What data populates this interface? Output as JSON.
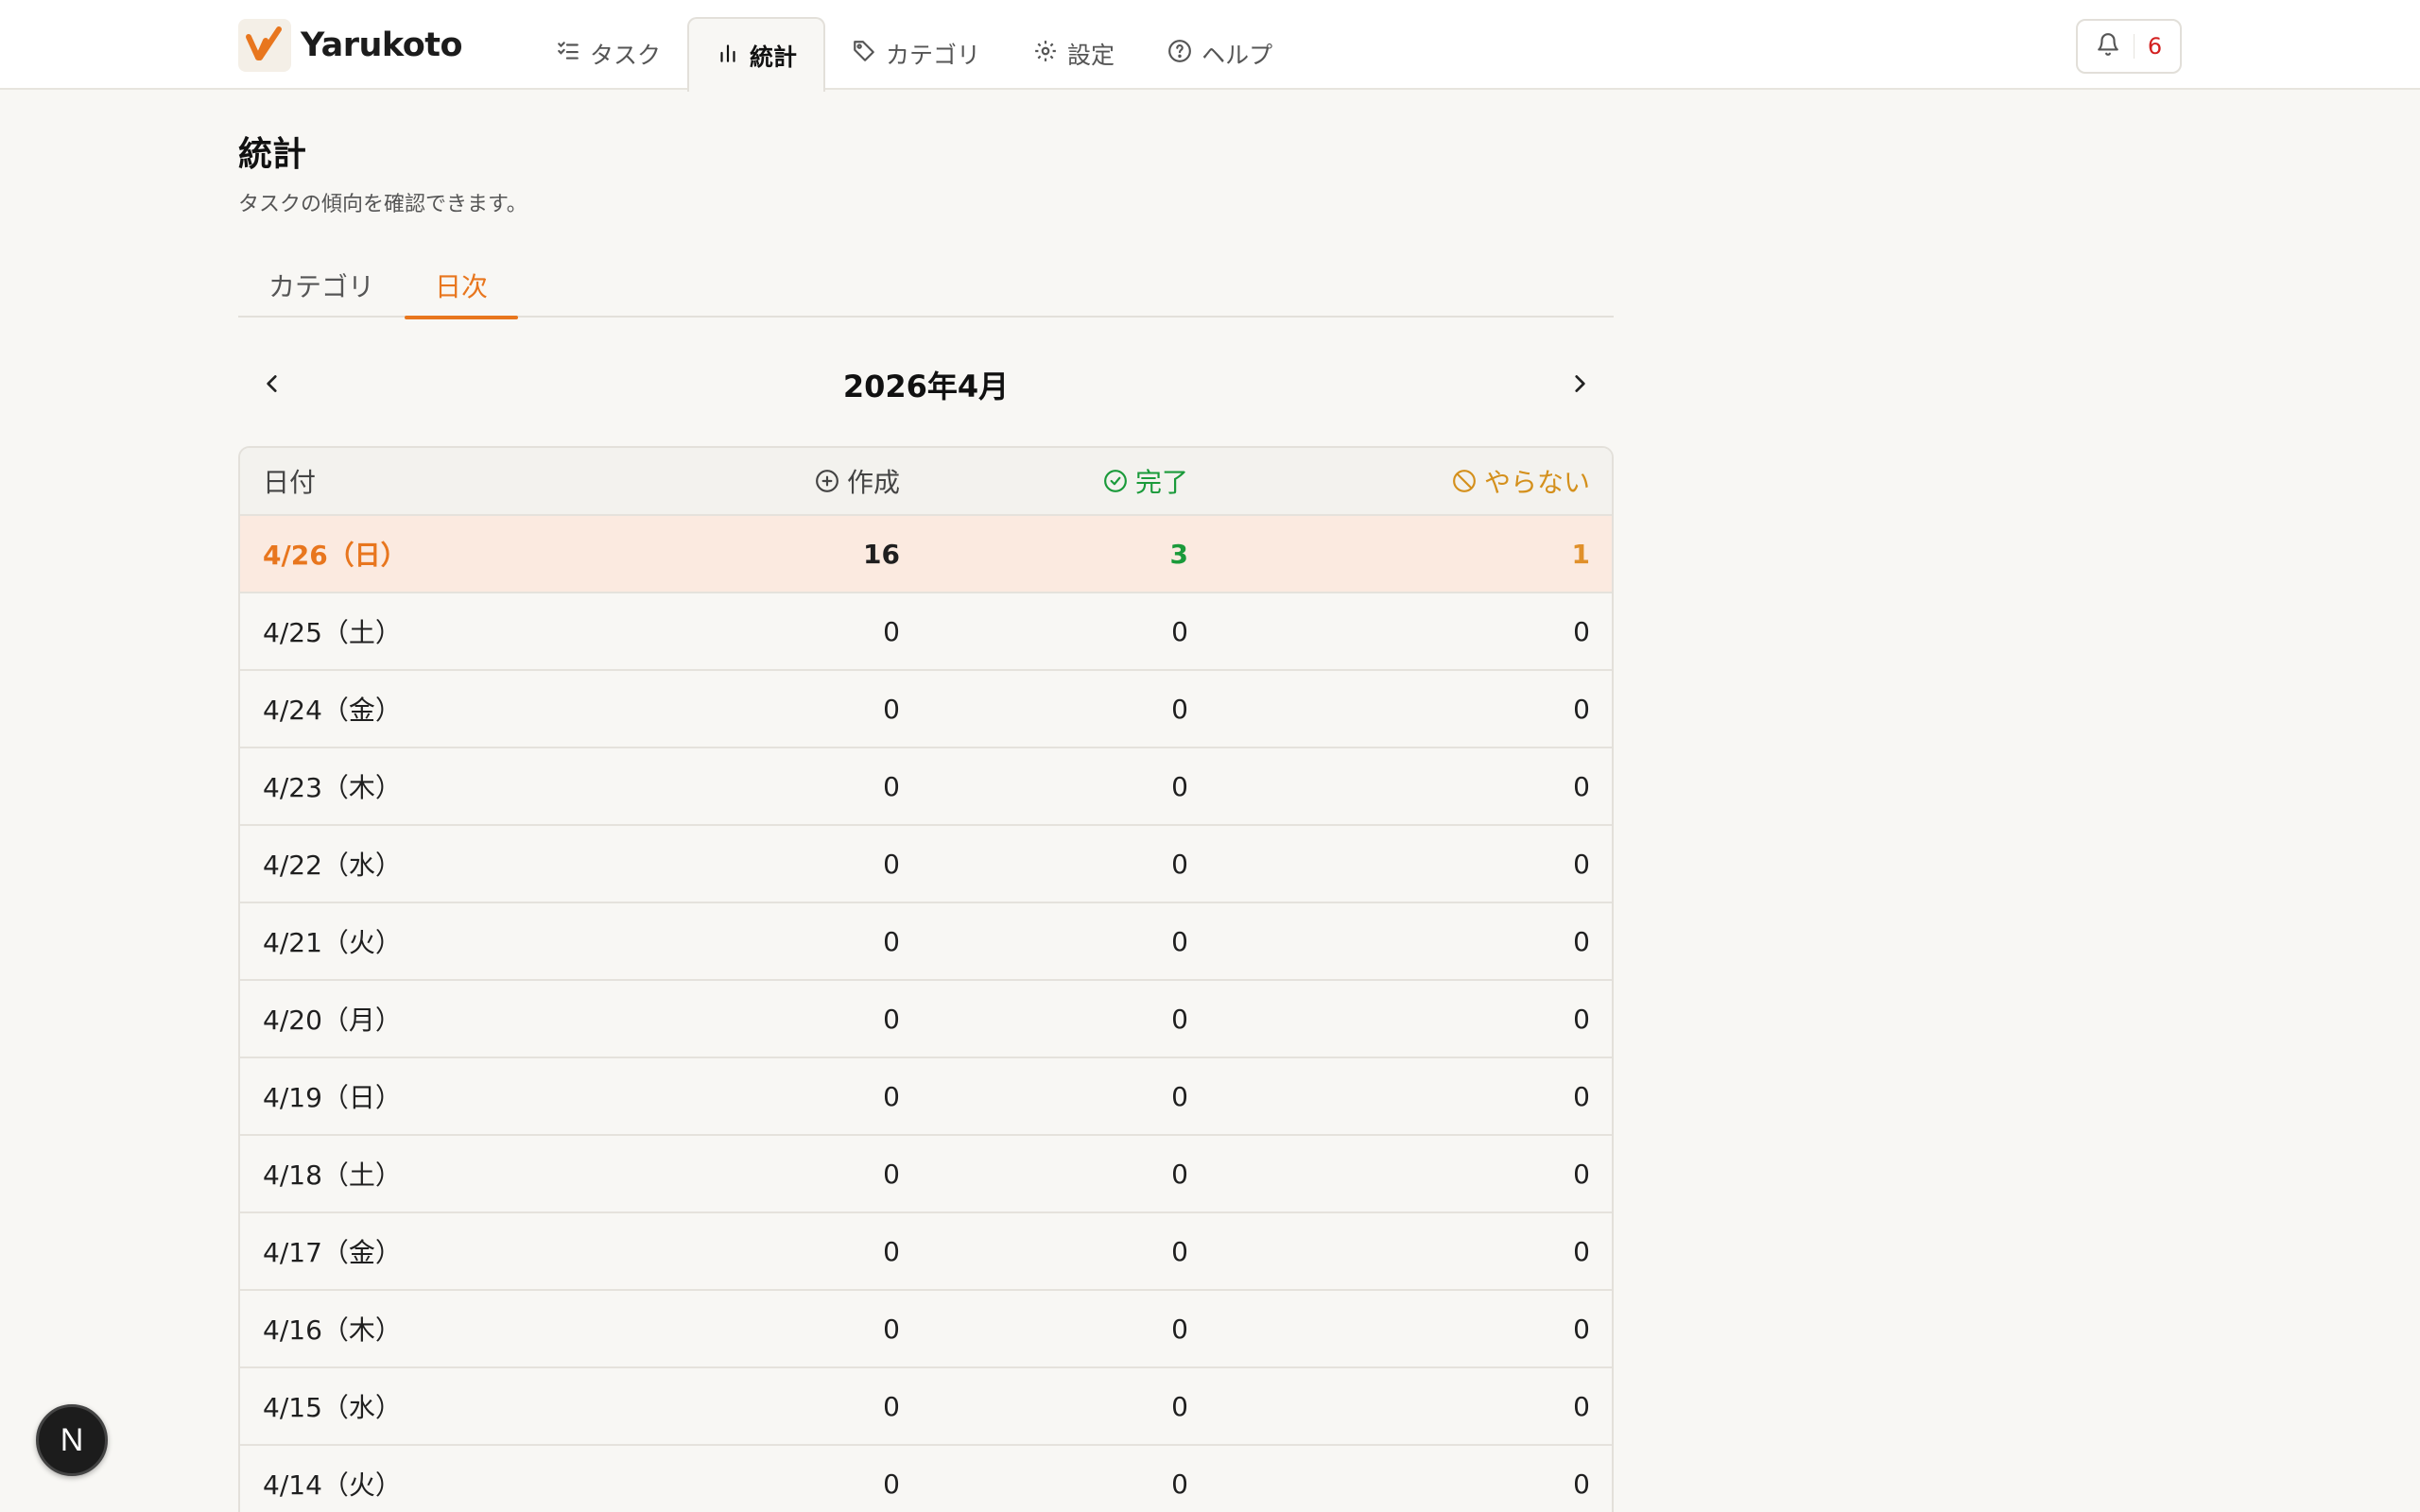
{
  "app": {
    "name": "Yarukoto"
  },
  "nav": {
    "items": [
      {
        "label": "タスク",
        "icon": "list-checks-icon"
      },
      {
        "label": "統計",
        "icon": "bar-chart-icon",
        "active": true
      },
      {
        "label": "カテゴリ",
        "icon": "tag-icon"
      },
      {
        "label": "設定",
        "icon": "gear-icon"
      },
      {
        "label": "ヘルプ",
        "icon": "help-circle-icon"
      }
    ]
  },
  "notifications": {
    "count": "6"
  },
  "page": {
    "title": "統計",
    "subtitle": "タスクの傾向を確認できます。"
  },
  "tabs": [
    {
      "label": "カテゴリ"
    },
    {
      "label": "日次",
      "active": true
    }
  ],
  "month": {
    "label": "2026年4月"
  },
  "table": {
    "headers": {
      "date": "日付",
      "created": "作成",
      "done": "完了",
      "skipped": "やらない"
    },
    "rows": [
      {
        "date": "4/26（日）",
        "created": "16",
        "done": "3",
        "skipped": "1"
      },
      {
        "date": "4/25（土）",
        "created": "0",
        "done": "0",
        "skipped": "0"
      },
      {
        "date": "4/24（金）",
        "created": "0",
        "done": "0",
        "skipped": "0"
      },
      {
        "date": "4/23（木）",
        "created": "0",
        "done": "0",
        "skipped": "0"
      },
      {
        "date": "4/22（水）",
        "created": "0",
        "done": "0",
        "skipped": "0"
      },
      {
        "date": "4/21（火）",
        "created": "0",
        "done": "0",
        "skipped": "0"
      },
      {
        "date": "4/20（月）",
        "created": "0",
        "done": "0",
        "skipped": "0"
      },
      {
        "date": "4/19（日）",
        "created": "0",
        "done": "0",
        "skipped": "0"
      },
      {
        "date": "4/18（土）",
        "created": "0",
        "done": "0",
        "skipped": "0"
      },
      {
        "date": "4/17（金）",
        "created": "0",
        "done": "0",
        "skipped": "0"
      },
      {
        "date": "4/16（木）",
        "created": "0",
        "done": "0",
        "skipped": "0"
      },
      {
        "date": "4/15（水）",
        "created": "0",
        "done": "0",
        "skipped": "0"
      },
      {
        "date": "4/14（火）",
        "created": "0",
        "done": "0",
        "skipped": "0"
      }
    ]
  },
  "colors": {
    "accent": "#e8761e",
    "done": "#1a9a3a",
    "skipped": "#e0902a",
    "badge": "#d32020"
  },
  "dev_badge": {
    "label": "N"
  }
}
